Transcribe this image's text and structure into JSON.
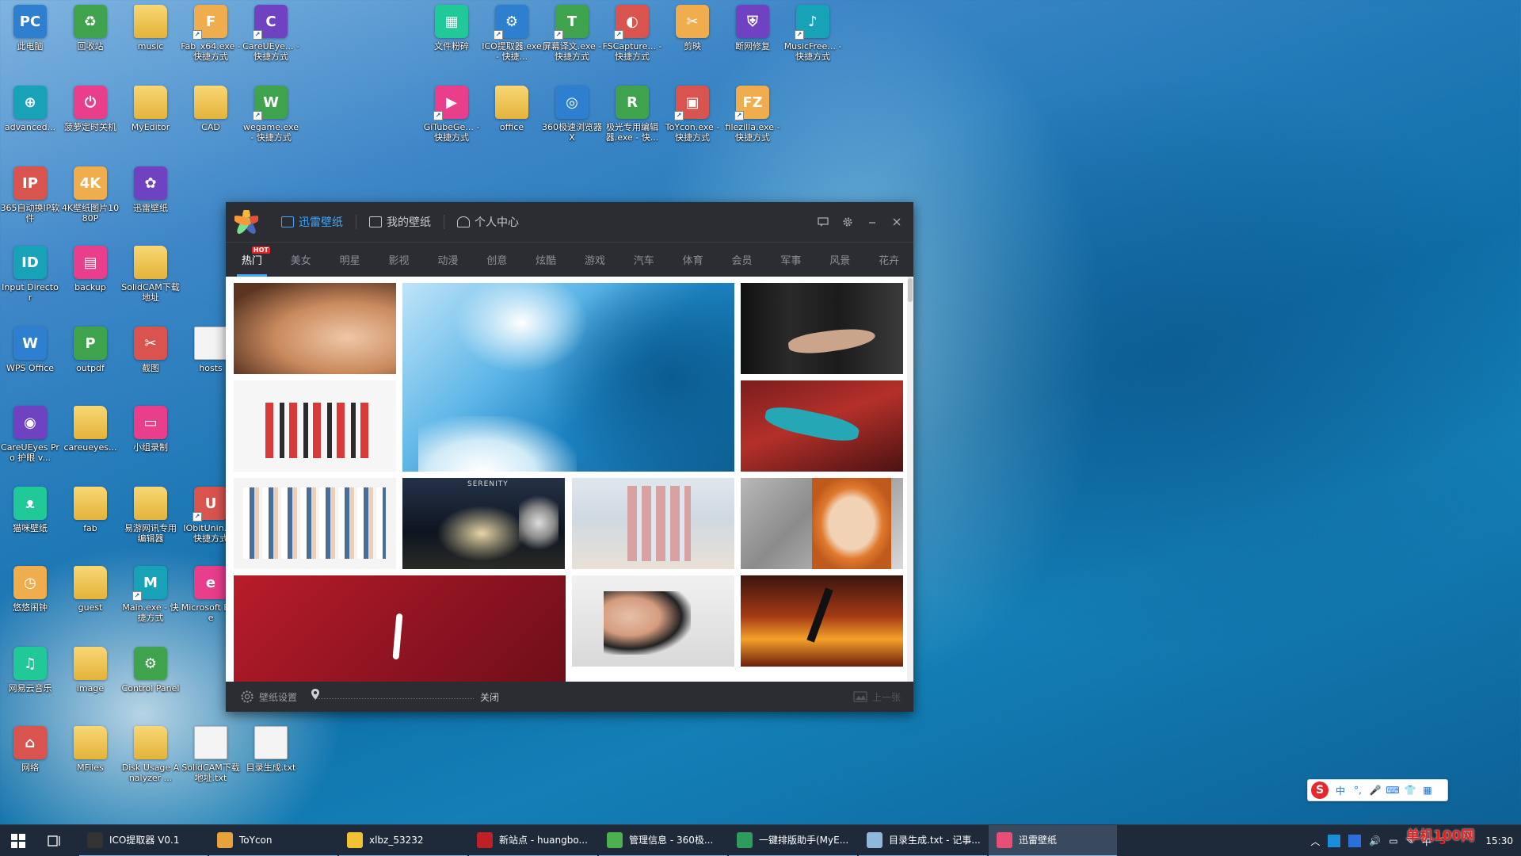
{
  "desktop": {
    "icons": [
      {
        "label": "此电脑",
        "glyph": "PC"
      },
      {
        "label": "回收站",
        "glyph": "♻"
      },
      {
        "label": "music",
        "glyph": ""
      },
      {
        "label": "Fab_x64.exe - 快捷方式",
        "glyph": "F"
      },
      {
        "label": "CareUEye... - 快捷方式",
        "glyph": "C"
      },
      {
        "label": "advanced...",
        "glyph": "⊕"
      },
      {
        "label": "菠萝定时关机",
        "glyph": "⏻"
      },
      {
        "label": "MyEditor",
        "glyph": ""
      },
      {
        "label": "CAD",
        "glyph": ""
      },
      {
        "label": "wegame.exe - 快捷方式",
        "glyph": "W"
      },
      {
        "label": "365自动换IP软件",
        "glyph": "IP"
      },
      {
        "label": "4K壁纸图片1080P",
        "glyph": "4K"
      },
      {
        "label": "迅雷壁纸",
        "glyph": "✿"
      },
      {
        "label": "Input Director",
        "glyph": "ID"
      },
      {
        "label": "backup",
        "glyph": "▤"
      },
      {
        "label": "SolidCAM下载地址",
        "glyph": ""
      },
      {
        "label": "WPS Office",
        "glyph": "W"
      },
      {
        "label": "outpdf",
        "glyph": "P"
      },
      {
        "label": "截图",
        "glyph": "✂"
      },
      {
        "label": "hosts",
        "glyph": ""
      },
      {
        "label": "CareUEyes Pro 护眼 v...",
        "glyph": "◉"
      },
      {
        "label": "careueyes...",
        "glyph": ""
      },
      {
        "label": "小组录制",
        "glyph": "▭"
      },
      {
        "label": "猫咪壁纸",
        "glyph": "ᴥ"
      },
      {
        "label": "fab",
        "glyph": ""
      },
      {
        "label": "易游网讯专用编辑器",
        "glyph": ""
      },
      {
        "label": "IObitUnin... - 快捷方式",
        "glyph": "U"
      },
      {
        "label": "悠悠闹钟",
        "glyph": "◷"
      },
      {
        "label": "guest",
        "glyph": ""
      },
      {
        "label": "Main.exe - 快捷方式",
        "glyph": "M"
      },
      {
        "label": "Microsoft Edge",
        "glyph": "e"
      },
      {
        "label": "网易云音乐",
        "glyph": "♫"
      },
      {
        "label": "image",
        "glyph": ""
      },
      {
        "label": "Control Panel",
        "glyph": "⚙"
      },
      {
        "label": "网络",
        "glyph": "⌂"
      },
      {
        "label": "MFiles",
        "glyph": ""
      },
      {
        "label": "Disk Usage Analyzer ...",
        "glyph": ""
      },
      {
        "label": "SolidCAM下载地址.txt",
        "glyph": ""
      },
      {
        "label": "目录生成.txt",
        "glyph": ""
      },
      {
        "label": "文件粉碎",
        "glyph": "▦"
      },
      {
        "label": "ICO提取器.exe - 快捷...",
        "glyph": "⚙"
      },
      {
        "label": "屏幕译文.exe - 快捷方式",
        "glyph": "T"
      },
      {
        "label": "FSCapture... - 快捷方式",
        "glyph": "◐"
      },
      {
        "label": "剪映",
        "glyph": "✂"
      },
      {
        "label": "断网修复",
        "glyph": "⛨"
      },
      {
        "label": "MusicFree... - 快捷方式",
        "glyph": "♪"
      },
      {
        "label": "GiTubeGe... - 快捷方式",
        "glyph": "▶"
      },
      {
        "label": "office",
        "glyph": ""
      },
      {
        "label": "360极速浏览器X",
        "glyph": "◎"
      },
      {
        "label": "极光专用编辑器.exe - 快...",
        "glyph": "R"
      },
      {
        "label": "ToYcon.exe - 快捷方式",
        "glyph": "▣"
      },
      {
        "label": "filezilla.exe - 快捷方式",
        "glyph": "FZ"
      }
    ]
  },
  "app": {
    "title_tabs": [
      {
        "label": "迅雷壁纸",
        "icon": "image-icon"
      },
      {
        "label": "我的壁纸",
        "icon": "favorite-image-icon"
      },
      {
        "label": "个人中心",
        "icon": "user-icon"
      }
    ],
    "categories": [
      "热门",
      "美女",
      "明星",
      "影视",
      "动漫",
      "创意",
      "炫酷",
      "游戏",
      "汽车",
      "体育",
      "会员",
      "军事",
      "风景",
      "花卉"
    ],
    "hot_badge": "HOT",
    "status": {
      "settings_label": "壁纸设置",
      "close_label": "关闭",
      "prev_label": "上一张"
    },
    "tile_texts": {
      "serenity": "SERENITY"
    }
  },
  "taskbar": {
    "items": [
      {
        "label": "ICO提取器 V0.1",
        "color": "#333333"
      },
      {
        "label": "ToYcon",
        "color": "#e6a23c"
      },
      {
        "label": "xlbz_53232",
        "color": "#f1c232"
      },
      {
        "label": "新站点 - huangbo...",
        "color": "#bf2026"
      },
      {
        "label": "管理信息 - 360极...",
        "color": "#4caf50"
      },
      {
        "label": "一键排版助手(MyE...",
        "color": "#2e9c5a"
      },
      {
        "label": "目录生成.txt - 记事...",
        "color": "#8fb7d9"
      },
      {
        "label": "迅雷壁纸",
        "color": "#e94e77"
      }
    ],
    "tray": {
      "lang": "中",
      "time": "15:30"
    }
  },
  "ime": {
    "mode": "中"
  },
  "watermark": "单机100网"
}
